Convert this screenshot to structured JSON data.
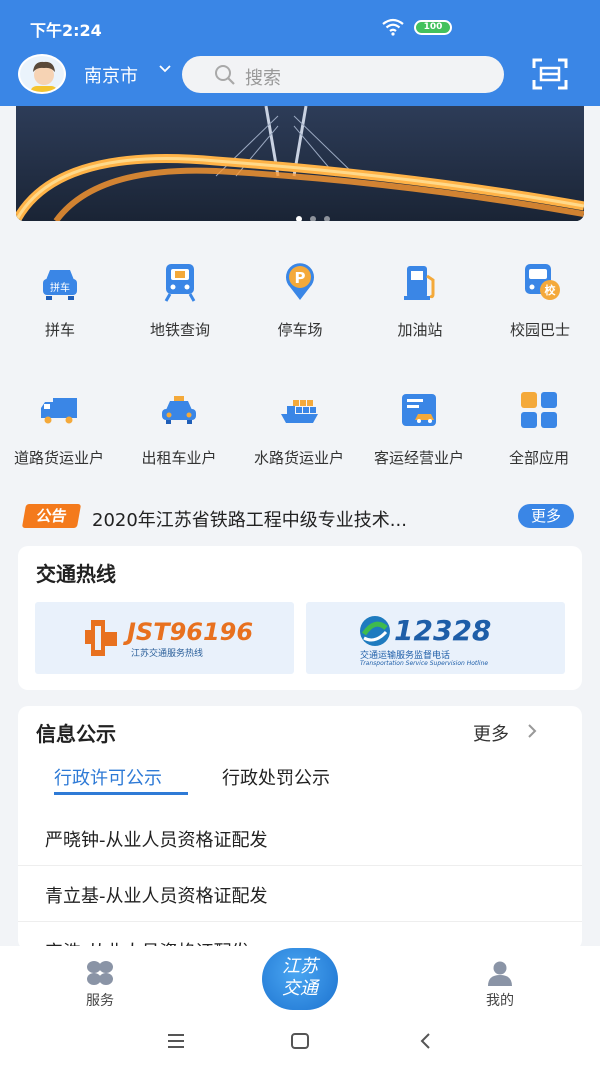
{
  "status": {
    "time": "下午2:24",
    "battery": "100"
  },
  "header": {
    "city": "南京市",
    "search_placeholder": "搜索"
  },
  "banner": {
    "slides": 3,
    "active_slide": 1
  },
  "services_row1": [
    {
      "label": "拼车",
      "icon": "carpool-icon",
      "badge": "拼车"
    },
    {
      "label": "地铁查询",
      "icon": "metro-icon"
    },
    {
      "label": "停车场",
      "icon": "parking-icon"
    },
    {
      "label": "加油站",
      "icon": "gas-station-icon"
    },
    {
      "label": "校园巴士",
      "icon": "school-bus-icon",
      "badge": "校"
    }
  ],
  "services_row2": [
    {
      "label": "道路货运业户",
      "icon": "truck-icon"
    },
    {
      "label": "出租车业户",
      "icon": "taxi-icon"
    },
    {
      "label": "水路货运业户",
      "icon": "cargo-ship-icon"
    },
    {
      "label": "客运经营业户",
      "icon": "passenger-transport-icon"
    },
    {
      "label": "全部应用",
      "icon": "all-apps-icon"
    }
  ],
  "notice": {
    "tag": "公告",
    "text": "2020年江苏省铁路工程中级专业技术...",
    "more": "更多"
  },
  "hotline": {
    "title": "交通热线",
    "items": [
      {
        "number": "JST96196",
        "caption": "江苏交通服务热线"
      },
      {
        "number": "12328",
        "caption": "交通运输服务监督电话",
        "caption_en": "Transportation Service Supervision Hotline"
      }
    ]
  },
  "info": {
    "title": "信息公示",
    "more": "更多",
    "tabs": [
      "行政许可公示",
      "行政处罚公示"
    ],
    "active_tab": 0,
    "rows": [
      "严晓钟-从业人员资格证配发",
      "青立基-从业人员资格证配发",
      "宋浩-从业人员资格证配发"
    ]
  },
  "tabbar": {
    "left": "服务",
    "center_logo": [
      "江苏",
      "交通"
    ],
    "right": "我的"
  },
  "colors": {
    "brand": "#3a86e6",
    "notice_tag": "#f47a1c",
    "active_tab": "#2e7ad6"
  }
}
